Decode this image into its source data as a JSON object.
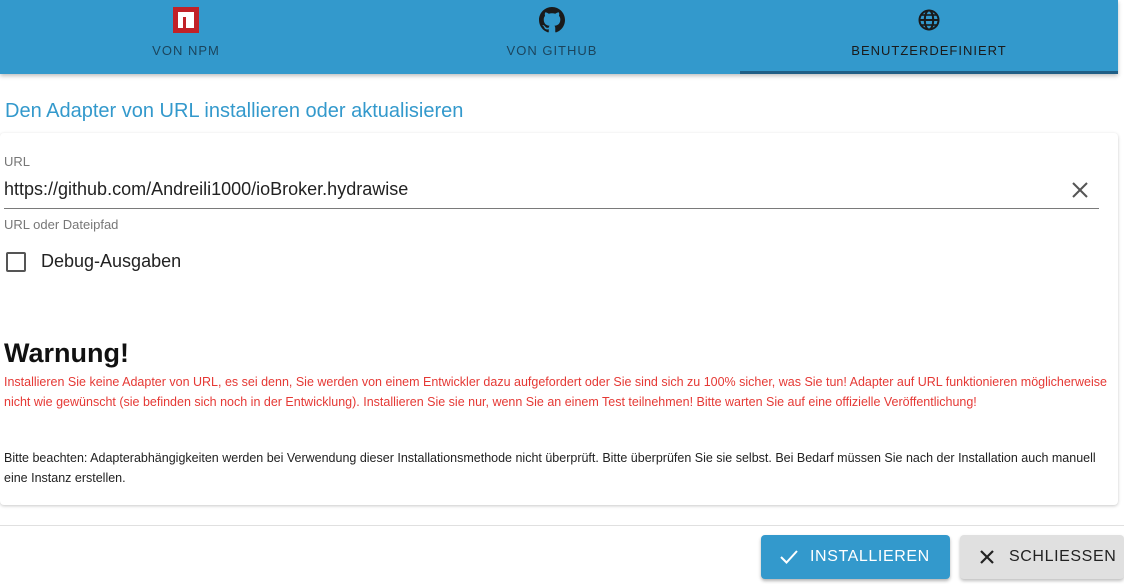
{
  "tabs": [
    {
      "label": "VON NPM",
      "icon": "npm-icon"
    },
    {
      "label": "VON GITHUB",
      "icon": "github-icon"
    },
    {
      "label": "BENUTZERDEFINIERT",
      "icon": "globe-icon",
      "active": true
    }
  ],
  "heading": "Den Adapter von URL installieren oder aktualisieren",
  "url_field": {
    "label": "URL",
    "value": "https://github.com/Andreili1000/ioBroker.hydrawise",
    "helper": "URL oder Dateipfad"
  },
  "debug_checkbox": {
    "label": "Debug-Ausgaben",
    "checked": false
  },
  "warning": {
    "title": "Warnung!",
    "text": "Installieren Sie keine Adapter von URL, es sei denn, Sie werden von einem Entwickler dazu aufgefordert oder Sie sind sich zu 100% sicher, was Sie tun! Adapter auf URL funktionieren möglicherweise nicht wie gewünscht (sie befinden sich noch in der Entwicklung). Installieren Sie sie nur, wenn Sie an einem Test teilnehmen! Bitte warten Sie auf eine offizielle Veröffentlichung!",
    "note": "Bitte beachten: Adapterabhängigkeiten werden bei Verwendung dieser Installationsmethode nicht überprüft. Bitte überprüfen Sie sie selbst. Bei Bedarf müssen Sie nach der Installation auch manuell eine Instanz erstellen."
  },
  "buttons": {
    "install": "INSTALLIEREN",
    "close": "SCHLIESSEN"
  },
  "colors": {
    "primary": "#3399cc",
    "warning": "#e53935",
    "npm": "#c12127"
  }
}
